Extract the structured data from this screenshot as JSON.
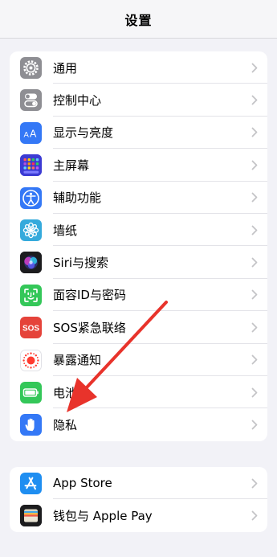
{
  "nav": {
    "title": "设置"
  },
  "settings_groups": [
    {
      "items": [
        {
          "id": "general",
          "label": "通用",
          "icon": "gear-icon",
          "color": "#8e8e93"
        },
        {
          "id": "control-center",
          "label": "控制中心",
          "icon": "switches-icon",
          "color": "#8e8e93"
        },
        {
          "id": "display",
          "label": "显示与亮度",
          "icon": "text-size-icon",
          "color": "#3478f6"
        },
        {
          "id": "home-screen",
          "label": "主屏幕",
          "icon": "app-grid-icon",
          "color": "#3c3bd3"
        },
        {
          "id": "accessibility",
          "label": "辅助功能",
          "icon": "accessibility-icon",
          "color": "#3478f6"
        },
        {
          "id": "wallpaper",
          "label": "墙纸",
          "icon": "flower-icon",
          "color": "#35aadc"
        },
        {
          "id": "siri",
          "label": "Siri与搜索",
          "icon": "siri-orb-icon",
          "color": "#1c1c1e"
        },
        {
          "id": "face-id",
          "label": "面容ID与密码",
          "icon": "face-id-icon",
          "color": "#34c759"
        },
        {
          "id": "sos",
          "label": "SOS紧急联络",
          "icon": "sos-icon",
          "color": "#e5433a"
        },
        {
          "id": "exposure",
          "label": "暴露通知",
          "icon": "exposure-dot-icon",
          "color": "#ffffff"
        },
        {
          "id": "battery",
          "label": "电池",
          "icon": "battery-icon",
          "color": "#34c759"
        },
        {
          "id": "privacy",
          "label": "隐私",
          "icon": "hand-icon",
          "color": "#3478f6"
        }
      ]
    },
    {
      "items": [
        {
          "id": "app-store",
          "label": "App Store",
          "icon": "app-store-icon",
          "color": "#1f8ef1"
        },
        {
          "id": "wallet",
          "label": "钱包与 Apple Pay",
          "icon": "wallet-icon",
          "color": "#1c1c1e"
        }
      ]
    }
  ],
  "chevron": {
    "icon": "chevron-right-icon",
    "color": "#c4c4c7"
  },
  "annotation": {
    "icon": "pointer-arrow-icon",
    "color": "#e8332b"
  }
}
